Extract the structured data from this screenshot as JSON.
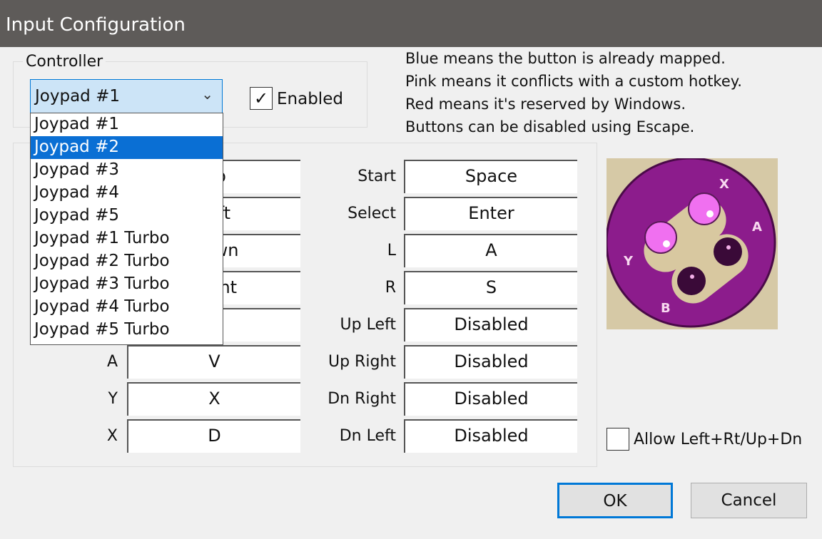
{
  "window": {
    "title": "Input Configuration"
  },
  "controller": {
    "group_label": "Controller",
    "selected": "Joypad #1",
    "enabled_label": "Enabled",
    "enabled_checked": true,
    "options": [
      "Joypad #1",
      "Joypad #2",
      "Joypad #3",
      "Joypad #4",
      "Joypad #5",
      "Joypad #1 Turbo",
      "Joypad #2 Turbo",
      "Joypad #3 Turbo",
      "Joypad #4 Turbo",
      "Joypad #5 Turbo"
    ],
    "highlighted_index": 1
  },
  "info": [
    "Blue means the button is already mapped.",
    "Pink means it conflicts with a custom hotkey.",
    "Red means it's reserved by Windows.",
    "Buttons can be disabled using Escape."
  ],
  "left_mappings": [
    {
      "label": "",
      "value": "Up"
    },
    {
      "label": "",
      "value": "Left"
    },
    {
      "label": "",
      "value": "Down"
    },
    {
      "label": "",
      "value": "Right"
    },
    {
      "label": "",
      "value": ""
    },
    {
      "label": "A",
      "value": "V"
    },
    {
      "label": "Y",
      "value": "X"
    },
    {
      "label": "X",
      "value": "D"
    }
  ],
  "right_mappings": [
    {
      "label": "Start",
      "value": "Space"
    },
    {
      "label": "Select",
      "value": "Enter"
    },
    {
      "label": "L",
      "value": "A"
    },
    {
      "label": "R",
      "value": "S"
    },
    {
      "label": "Up Left",
      "value": "Disabled"
    },
    {
      "label": "Up Right",
      "value": "Disabled"
    },
    {
      "label": "Dn Right",
      "value": "Disabled"
    },
    {
      "label": "Dn Left",
      "value": "Disabled"
    }
  ],
  "controller_image": {
    "labels": [
      "X",
      "A",
      "Y",
      "B"
    ],
    "colors": {
      "pad": "#8c1c8c",
      "pink": "#f070f0",
      "dark": "#3a0a38",
      "tan": "#d8c8a0"
    }
  },
  "allow_opposite": {
    "label": "Allow Left+Rt/Up+Dn",
    "checked": false
  },
  "buttons": {
    "ok": "OK",
    "cancel": "Cancel"
  }
}
